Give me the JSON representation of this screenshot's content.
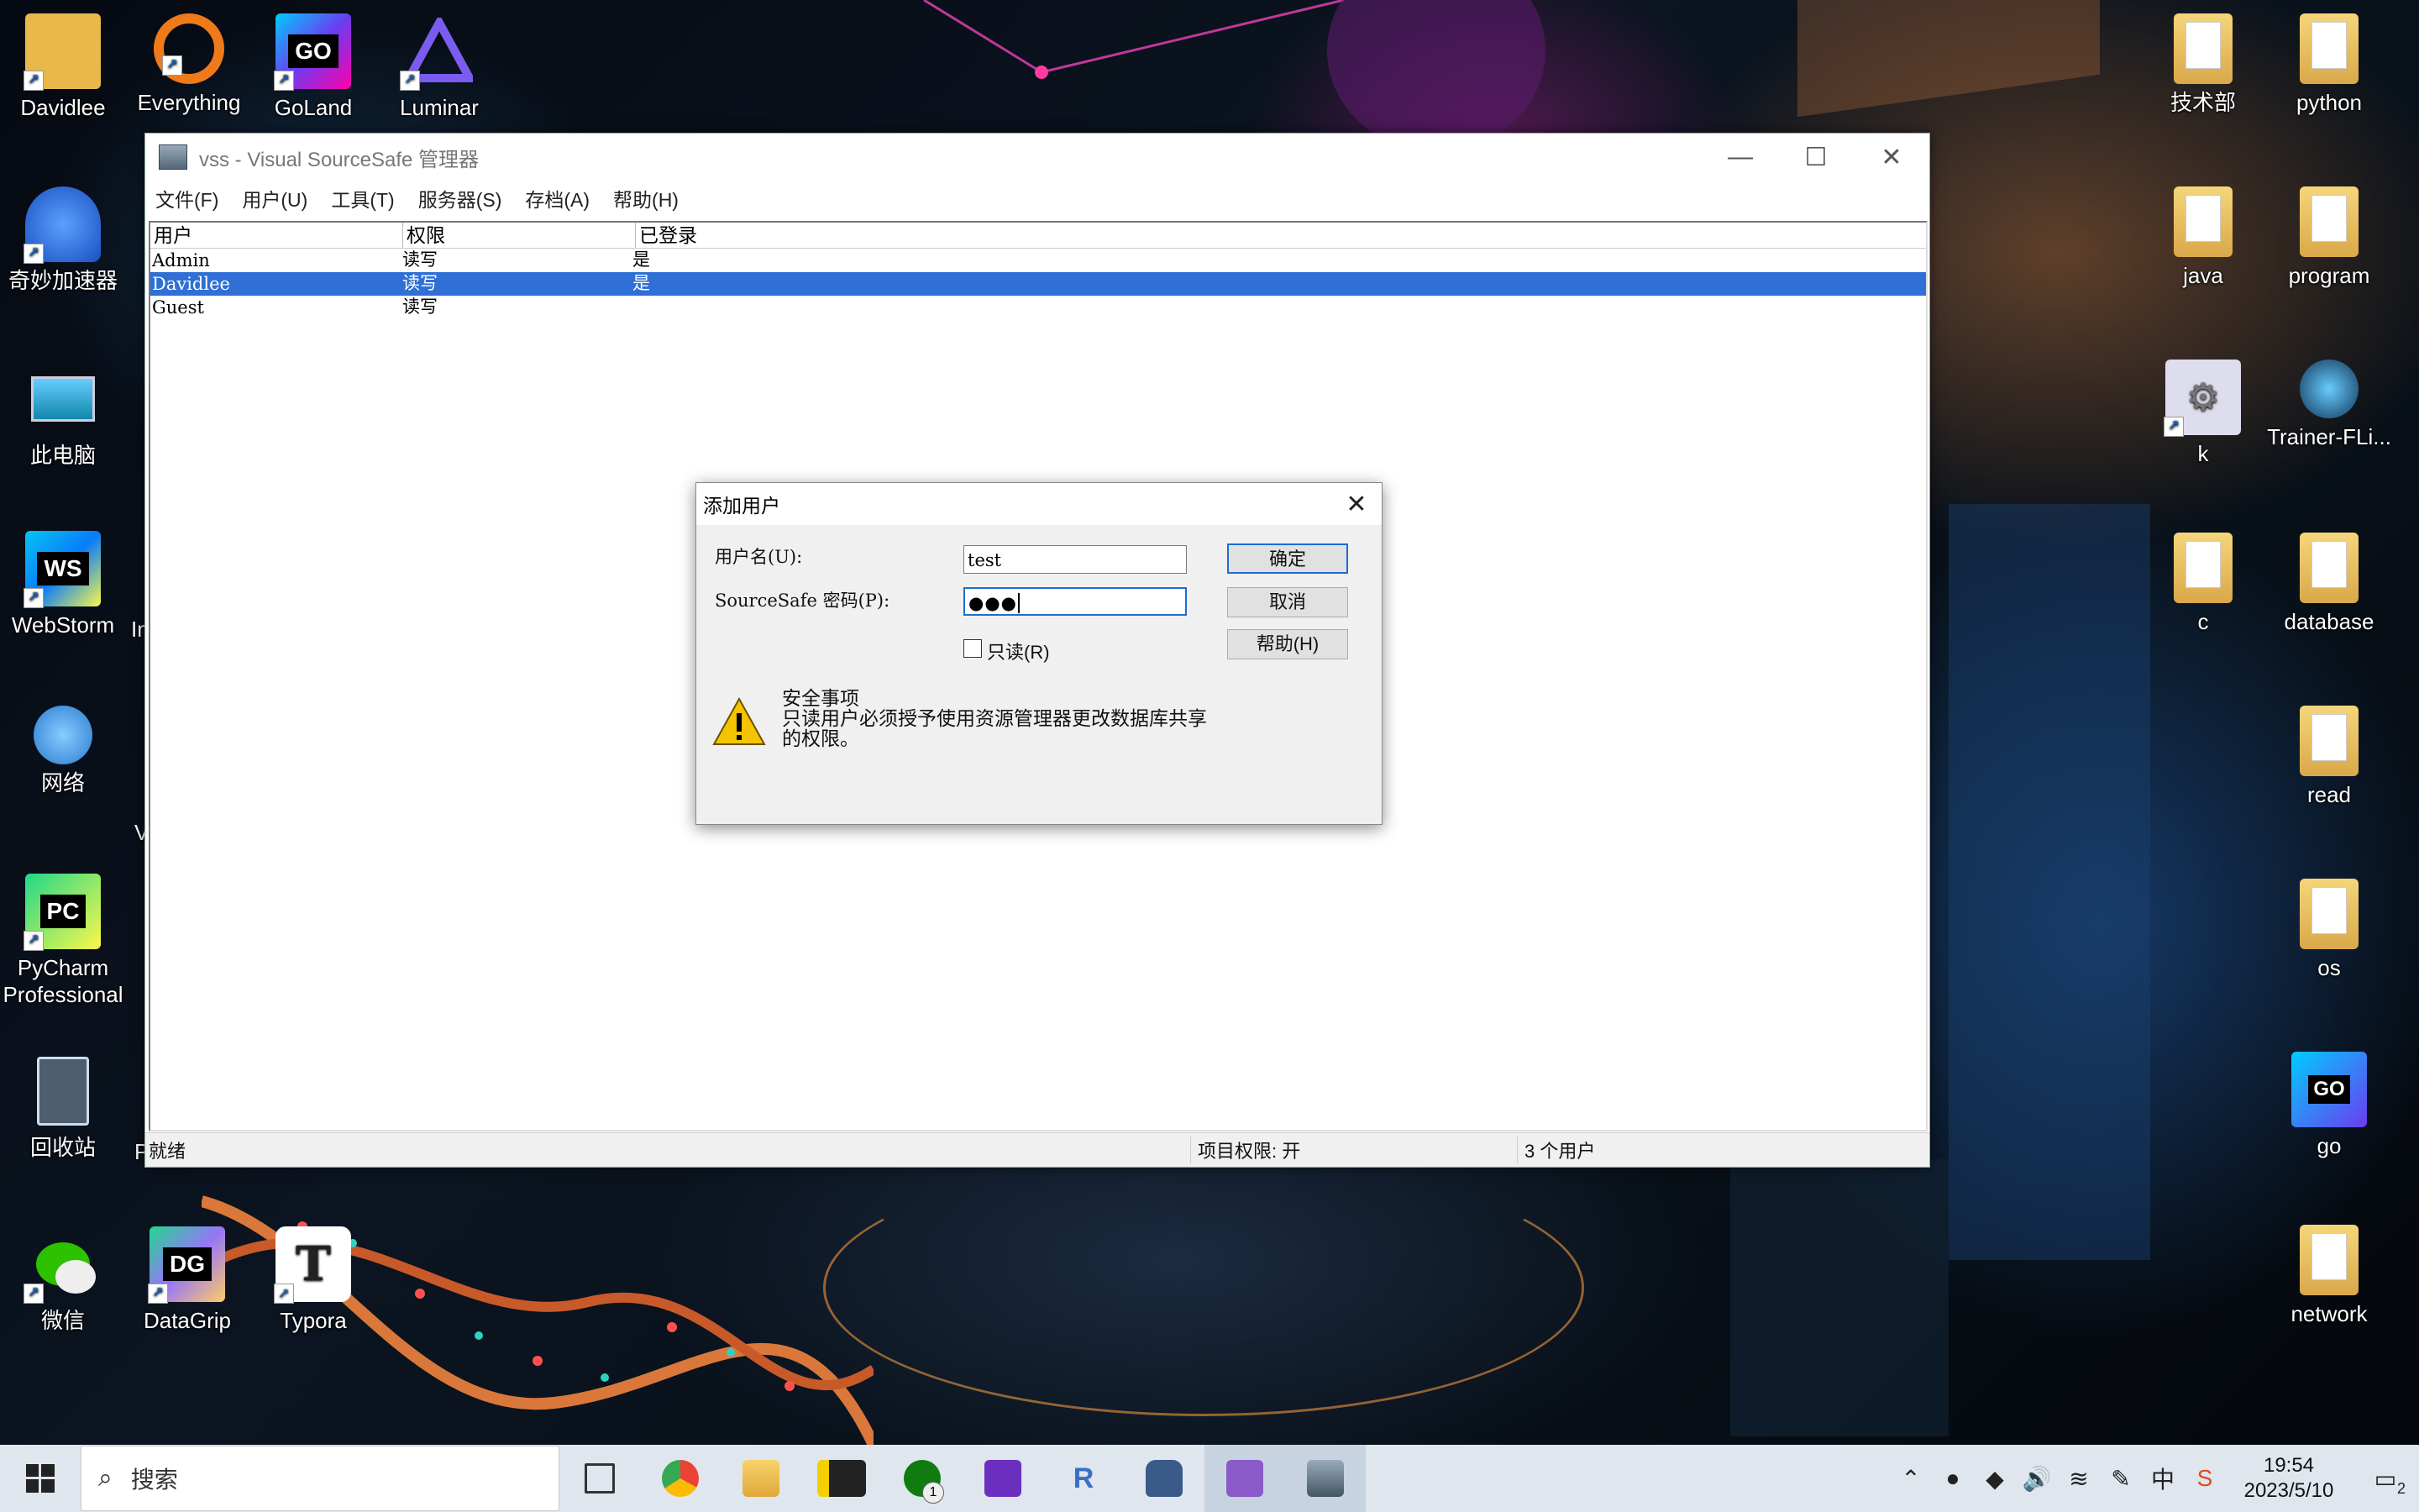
{
  "desktop": {
    "icons_left": [
      {
        "label": "Davidlee",
        "icon": "user-folder-icon",
        "color": "#e8b84a"
      },
      {
        "label": "Everything",
        "icon": "everything-search-icon",
        "color": "#f07a1a"
      },
      {
        "label": "GoLand",
        "icon": "goland-icon",
        "color": "#3a6cf0",
        "glyph": "GO"
      },
      {
        "label": "Luminar",
        "icon": "luminar-icon",
        "color": "#6a4cf0"
      },
      {
        "label": "奇妙加速器",
        "icon": "accelerator-icon",
        "color": "#2a70e0"
      },
      {
        "label": "此电脑",
        "icon": "computer-icon",
        "color": "#3a9ae0"
      },
      {
        "label": "WebStorm",
        "icon": "webstorm-icon",
        "color": "#1aa0e0",
        "glyph": "WS"
      },
      {
        "label": "网络",
        "icon": "network-icon",
        "color": "#3a9ae0"
      },
      {
        "label": "PyCharm\nProfessional",
        "icon": "pycharm-icon",
        "color": "#21d789",
        "glyph": "PC"
      },
      {
        "label": "回收站",
        "icon": "recycle-bin-icon",
        "color": "#9ab8d0"
      },
      {
        "label": "微信",
        "icon": "wechat-icon",
        "color": "#2dc100"
      },
      {
        "label": "DataGrip",
        "icon": "datagrip-icon",
        "color": "#22d88f",
        "glyph": "DG"
      },
      {
        "label": "Typora",
        "icon": "typora-icon",
        "color": "#ffffff",
        "glyph": "T"
      }
    ],
    "icons_right": [
      {
        "label": "技术部",
        "icon": "folder-icon"
      },
      {
        "label": "python",
        "icon": "folder-icon"
      },
      {
        "label": "java",
        "icon": "folder-icon"
      },
      {
        "label": "program",
        "icon": "folder-icon"
      },
      {
        "label": "k",
        "icon": "settings-shortcut-icon"
      },
      {
        "label": "Trainer-FLi...",
        "icon": "trainer-icon"
      },
      {
        "label": "c",
        "icon": "folder-icon"
      },
      {
        "label": "database",
        "icon": "folder-icon"
      },
      {
        "label": "read",
        "icon": "folder-icon"
      },
      {
        "label": "os",
        "icon": "folder-icon"
      },
      {
        "label": "go",
        "icon": "go-file-icon"
      },
      {
        "label": "network",
        "icon": "folder-icon"
      }
    ],
    "partial_labels": [
      "In",
      "V",
      "P"
    ]
  },
  "window": {
    "title": "vss - Visual SourceSafe 管理器",
    "menu": [
      "文件(F)",
      "用户(U)",
      "工具(T)",
      "服务器(S)",
      "存档(A)",
      "帮助(H)"
    ],
    "columns": [
      "用户",
      "权限",
      "已登录"
    ],
    "rows": [
      {
        "user": "Admin",
        "rights": "读写",
        "logged": "是",
        "selected": false
      },
      {
        "user": "Davidlee",
        "rights": "读写",
        "logged": "是",
        "selected": true
      },
      {
        "user": "Guest",
        "rights": "读写",
        "logged": "",
        "selected": false
      }
    ],
    "status": {
      "ready": "就绪",
      "project_rights": "项目权限: 开",
      "user_count": "3 个用户"
    }
  },
  "dialog": {
    "title": "添加用户",
    "username_label": "用户名(U):",
    "username_value": "test",
    "password_label": "SourceSafe 密码(P):",
    "password_value": "●●●",
    "readonly_label": "只读(R)",
    "ok_label": "确定",
    "cancel_label": "取消",
    "help_label": "帮助(H)",
    "note_line1": "安全事项",
    "note_line2": "只读用户必须授予使用资源管理器更改数据库共享",
    "note_line3": "的权限。"
  },
  "taskbar": {
    "search_placeholder": "搜索",
    "apps": [
      "task-view-icon",
      "chrome-icon",
      "file-explorer-icon",
      "sticky-notes-icon",
      "xbox-icon",
      "app-icon",
      "rider-icon",
      "cat-icon",
      "notes-icon",
      "vss-icon"
    ],
    "xbox_badge": "1",
    "time": "19:54",
    "date": "2023/5/10",
    "ime": "中",
    "notif_count": "2"
  }
}
